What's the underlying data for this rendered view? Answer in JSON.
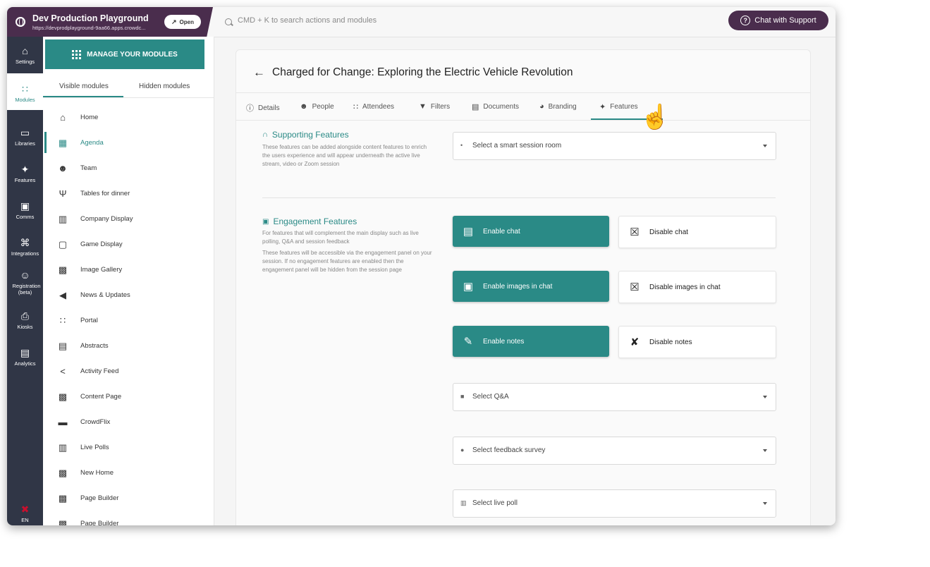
{
  "app": {
    "title": "Dev Production Playground",
    "url": "https://devprodplayground-9aa66.apps.crowdc...",
    "open_label": "Open"
  },
  "search": {
    "placeholder": "CMD + K to search actions and modules"
  },
  "support": {
    "label": "Chat with Support"
  },
  "rail": {
    "items": [
      {
        "label": "Settings",
        "icon": "home-icon"
      },
      {
        "label": "Modules",
        "icon": "grid-icon",
        "active": true
      },
      {
        "label": "Libraries",
        "icon": "folder-icon"
      },
      {
        "label": "Features",
        "icon": "sparkle-icon"
      },
      {
        "label": "Comms",
        "icon": "chat-icon"
      },
      {
        "label": "Integrations",
        "icon": "puzzle-icon"
      },
      {
        "label": "Registration (beta)",
        "icon": "person-check-icon"
      },
      {
        "label": "Kiosks",
        "icon": "printer-icon"
      },
      {
        "label": "Analytics",
        "icon": "analytics-icon"
      }
    ],
    "language": "EN"
  },
  "modules_panel": {
    "manage_label": "MANAGE YOUR MODULES",
    "tabs": [
      "Visible modules",
      "Hidden modules"
    ],
    "items": [
      {
        "label": "Home",
        "icon": "home-icon"
      },
      {
        "label": "Agenda",
        "icon": "calendar-icon",
        "active": true
      },
      {
        "label": "Team",
        "icon": "team-icon"
      },
      {
        "label": "Tables for dinner",
        "icon": "utensils-icon"
      },
      {
        "label": "Company Display",
        "icon": "building-icon"
      },
      {
        "label": "Game Display",
        "icon": "gamepad-icon"
      },
      {
        "label": "Image Gallery",
        "icon": "layout-icon"
      },
      {
        "label": "News & Updates",
        "icon": "megaphone-icon"
      },
      {
        "label": "Portal",
        "icon": "grid-icon"
      },
      {
        "label": "Abstracts",
        "icon": "pdf-icon"
      },
      {
        "label": "Activity Feed",
        "icon": "share-icon"
      },
      {
        "label": "Content Page",
        "icon": "layout-icon"
      },
      {
        "label": "CrowdFlix",
        "icon": "clapper-icon"
      },
      {
        "label": "Live Polls",
        "icon": "poll-icon"
      },
      {
        "label": "New Home",
        "icon": "layout-icon"
      },
      {
        "label": "Page Builder",
        "icon": "layout-icon"
      },
      {
        "label": "Page Builder",
        "icon": "layout-icon"
      }
    ]
  },
  "main": {
    "title": "Charged for Change: Exploring the Electric Vehicle Revolution",
    "tabs": [
      {
        "label": "Details",
        "icon": "info-icon"
      },
      {
        "label": "People",
        "icon": "people-icon"
      },
      {
        "label": "Attendees",
        "icon": "attendees-icon"
      },
      {
        "label": "Filters",
        "icon": "filter-icon"
      },
      {
        "label": "Documents",
        "icon": "document-icon"
      },
      {
        "label": "Branding",
        "icon": "palette-icon"
      },
      {
        "label": "Features",
        "icon": "sparkle-icon",
        "active": true
      }
    ],
    "supporting": {
      "title": "Supporting Features",
      "desc": "These features can be added alongside content features to enrich the users experience and will appear underneath the active live stream, video or Zoom session",
      "select_label": "Select a smart session room"
    },
    "engagement": {
      "title": "Engagement Features",
      "desc1": "For features that will complement the main display such as live polling, Q&A and session feedback",
      "desc2": "These features will be accessible via the engagement panel on your session. If no engagement features are enabled then the engagement panel will be hidden from the session page",
      "enable_chat": "Enable chat",
      "disable_chat": "Disable chat",
      "enable_images": "Enable images in chat",
      "disable_images": "Disable images in chat",
      "enable_notes": "Enable notes",
      "disable_notes": "Disable notes",
      "qa_select": "Select Q&A",
      "feedback_select": "Select feedback survey",
      "poll_select": "Select live poll"
    }
  },
  "colors": {
    "accent": "#2a8a86",
    "brand": "#4a2d4d",
    "rail": "#303646"
  }
}
